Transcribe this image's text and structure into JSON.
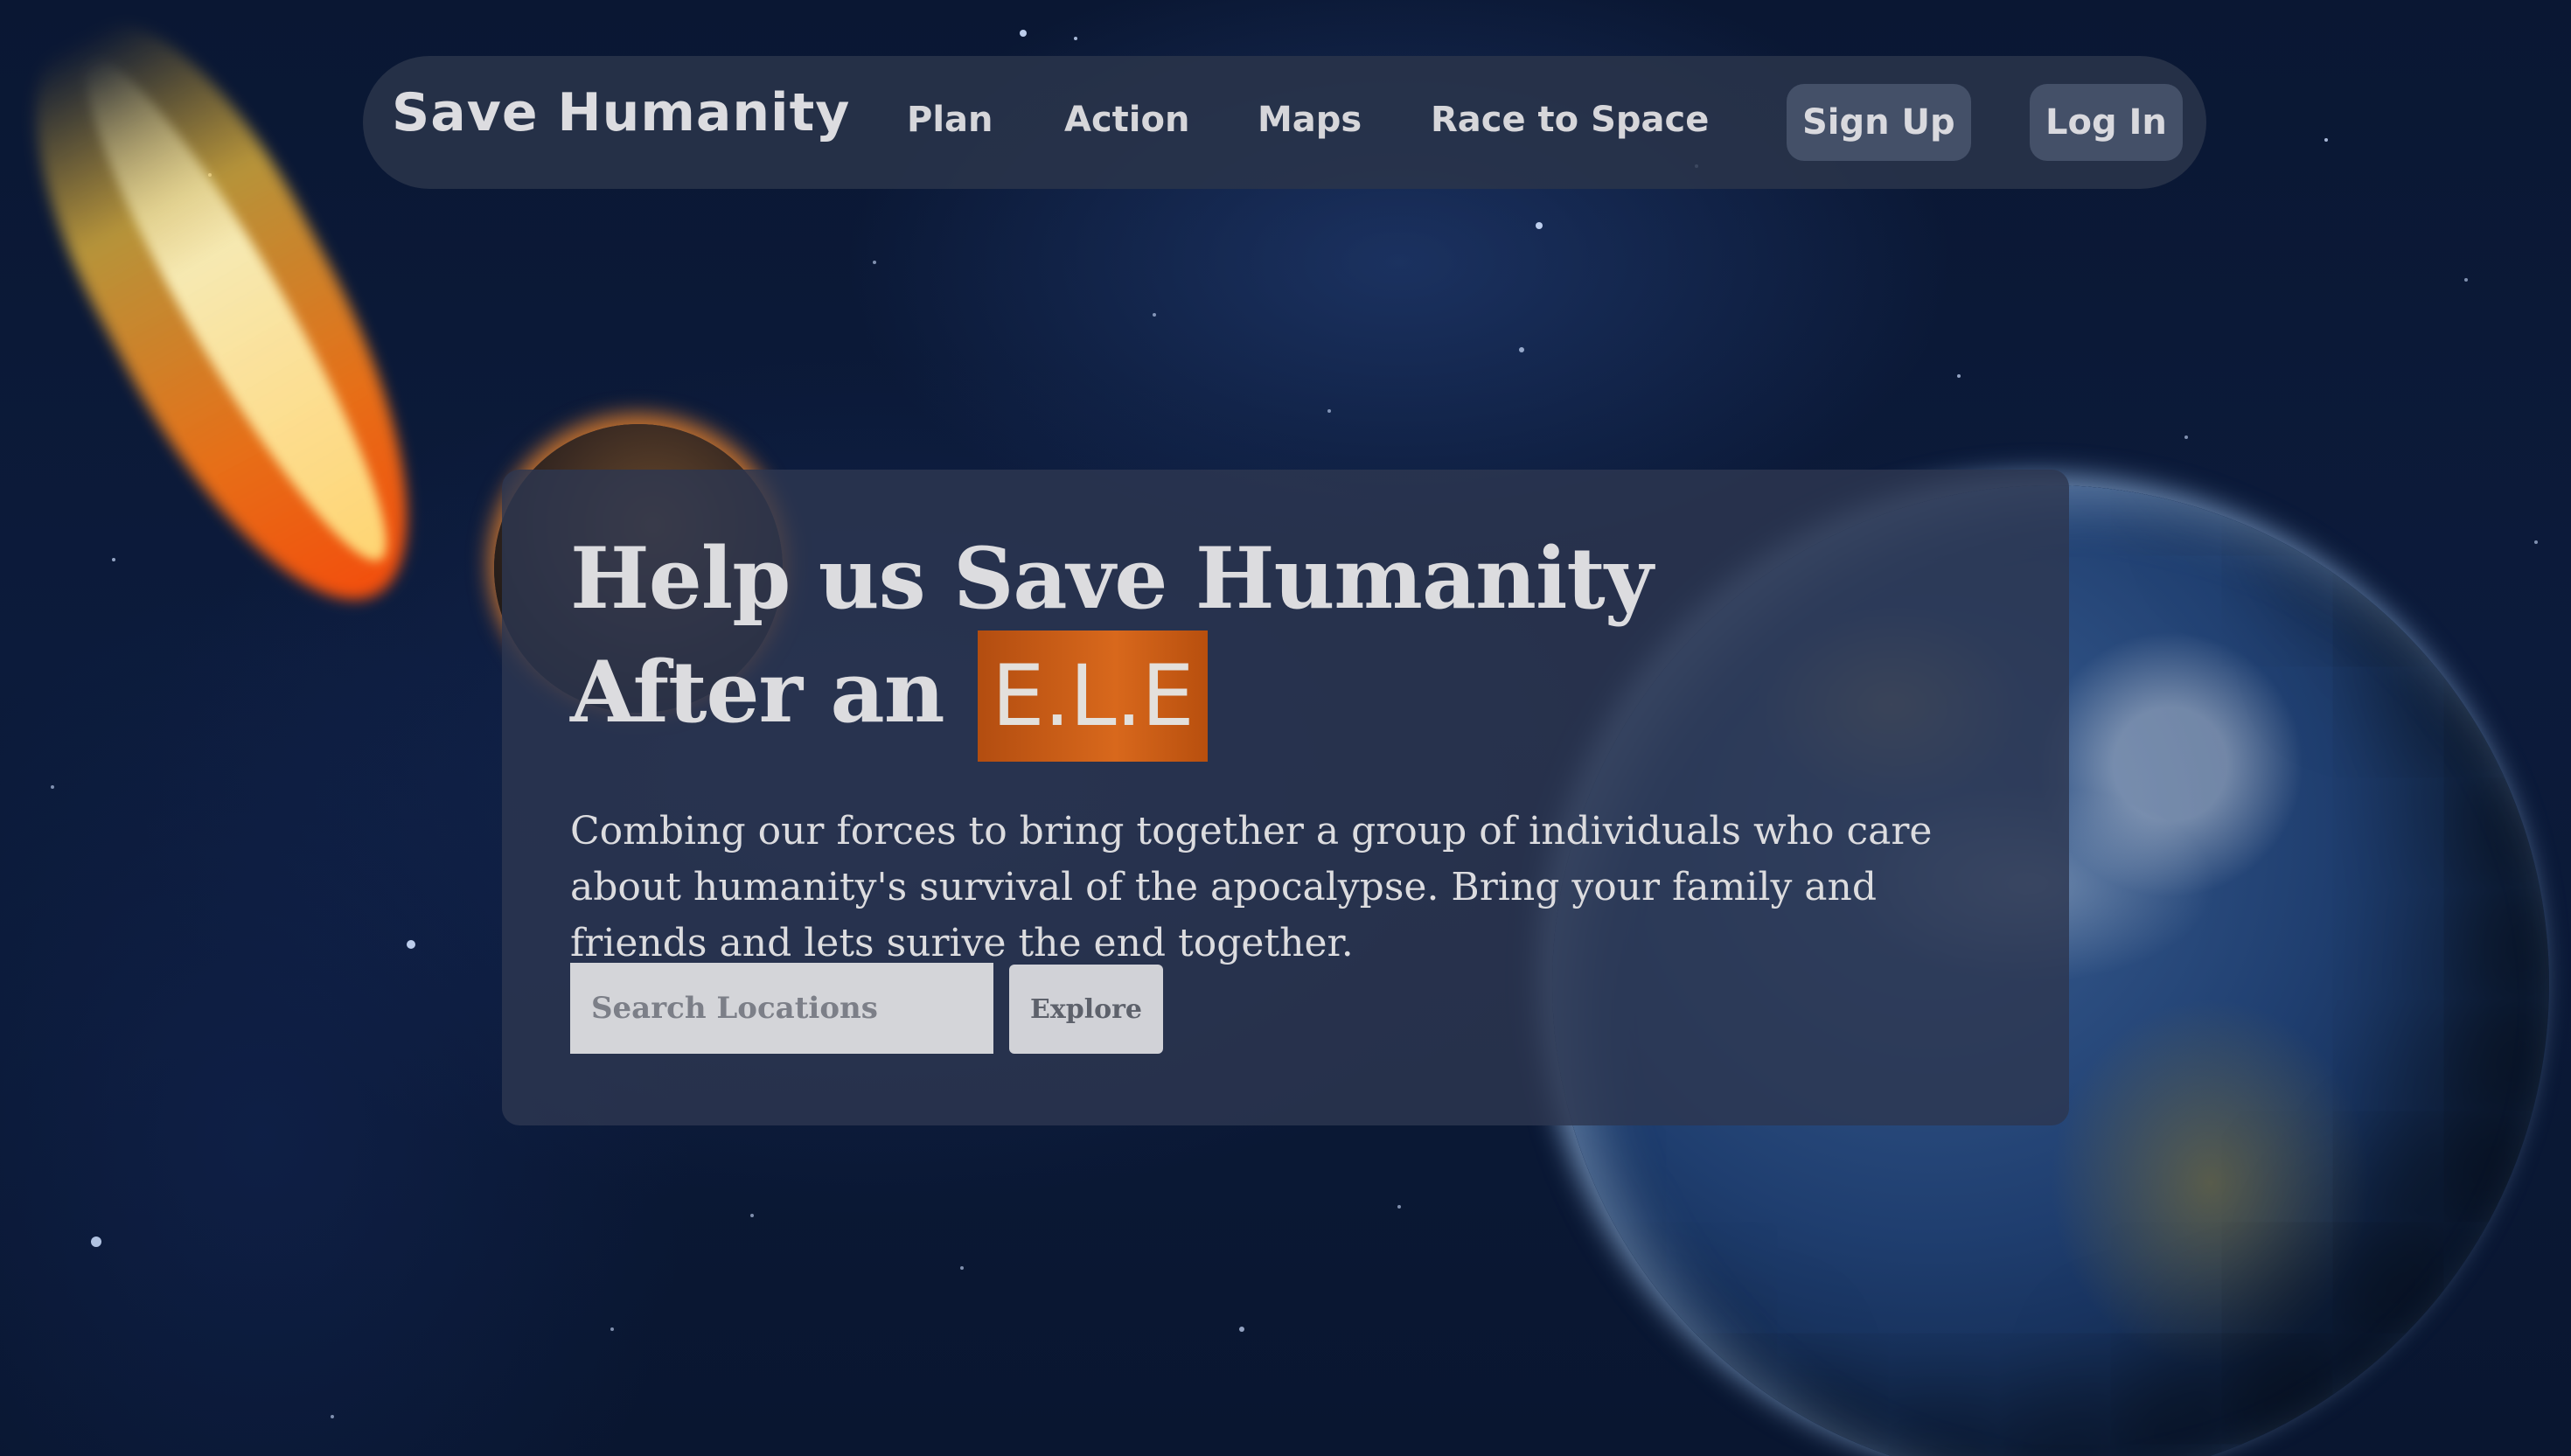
{
  "nav": {
    "brand": "Save Humanity",
    "links": [
      "Plan",
      "Action",
      "Maps",
      "Race to Space"
    ],
    "signup_label": "Sign Up",
    "login_label": "Log In"
  },
  "hero": {
    "title_line1": "Help us Save Humanity",
    "title_line2_prefix": "After an",
    "title_highlight": "E.L.E",
    "description": "Combing our forces to bring together a group of individuals who care about humanity's survival of the apocalypse. Bring your family and friends and lets surive the end together.",
    "search_placeholder": "Search Locations",
    "explore_label": "Explore"
  },
  "colors": {
    "highlight": "#d8681c",
    "nav_bg": "#2a344a",
    "card_bg": "#2d3750"
  }
}
